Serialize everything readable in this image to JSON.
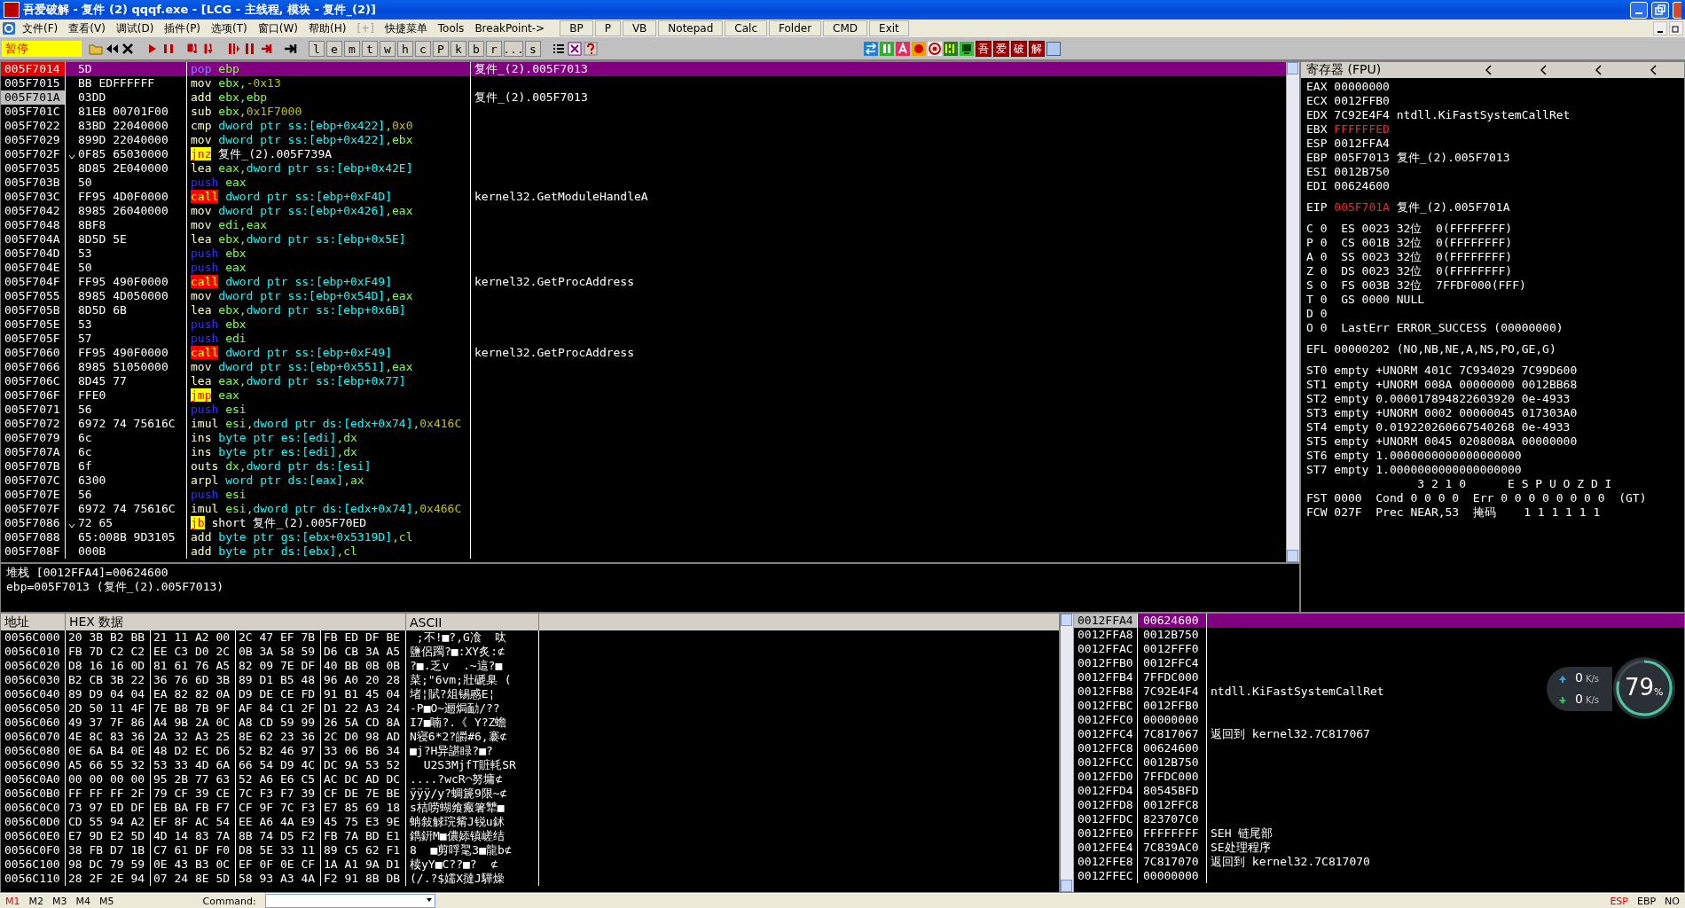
{
  "window": {
    "title": "吾爱破解 - 复件 (2) qqqf.exe - [LCG - 主线程, 模块 - 复件_(2)]"
  },
  "menu": [
    {
      "label": "文件(F)",
      "disabled": false
    },
    {
      "label": "查看(V)",
      "disabled": false
    },
    {
      "label": "调试(D)",
      "disabled": false
    },
    {
      "label": "插件(P)",
      "disabled": false
    },
    {
      "label": "选项(T)",
      "disabled": false
    },
    {
      "label": "窗口(W)",
      "disabled": false
    },
    {
      "label": "帮助(H)",
      "disabled": false
    },
    {
      "label": "[+]",
      "disabled": true
    },
    {
      "label": "快捷菜单",
      "disabled": false
    },
    {
      "label": "Tools",
      "disabled": false
    },
    {
      "label": "BreakPoint->",
      "disabled": false
    }
  ],
  "menu_buttons": [
    "BP",
    "P",
    "VB",
    "Notepad",
    "Calc",
    "Folder",
    "CMD",
    "Exit"
  ],
  "toolbar": {
    "status": "暂停",
    "letter_buttons": [
      "l",
      "e",
      "m",
      "t",
      "w",
      "h",
      "c",
      "P",
      "k",
      "b",
      "r",
      "...",
      "s"
    ],
    "brand_buttons": [
      "吾",
      "爱",
      "破",
      "解"
    ]
  },
  "disassembly": {
    "rows": [
      {
        "address": "005F7014",
        "hex": "5D",
        "mnemonic": "pop",
        "operands": "ebp",
        "kind": "stack",
        "branch": false,
        "selected": true,
        "current": false,
        "comment": "复件_(2).005F7013"
      },
      {
        "address": "005F7015",
        "hex": "BB EDFFFFFF",
        "mnemonic": "mov",
        "operands": "ebx,-0x13",
        "kind": "plain",
        "branch": false,
        "selected": false,
        "current": false
      },
      {
        "address": "005F701A",
        "hex": "03DD",
        "mnemonic": "add",
        "operands": "ebx,ebp",
        "kind": "plain",
        "branch": false,
        "selected": false,
        "current": true,
        "comment": "复件_(2).005F7013"
      },
      {
        "address": "005F701C",
        "hex": "81EB 00701F00",
        "mnemonic": "sub",
        "operands": "ebx,0x1F7000",
        "kind": "plain",
        "branch": false,
        "selected": false,
        "current": false
      },
      {
        "address": "005F7022",
        "hex": "83BD 22040000",
        "mnemonic": "cmp",
        "operands": "dword ptr ss:[ebp+0x422],0x0",
        "kind": "plain",
        "branch": false,
        "selected": false,
        "current": false
      },
      {
        "address": "005F7029",
        "hex": "899D 22040000",
        "mnemonic": "mov",
        "operands": "dword ptr ss:[ebp+0x422],ebx",
        "kind": "plain",
        "branch": false,
        "selected": false,
        "current": false
      },
      {
        "address": "005F702F",
        "hex": "0F85 65030000",
        "mnemonic": "jnz",
        "operands": "复件_(2).005F739A",
        "kind": "jump",
        "branch": true,
        "selected": false,
        "current": false
      },
      {
        "address": "005F7035",
        "hex": "8D85 2E040000",
        "mnemonic": "lea",
        "operands": "eax,dword ptr ss:[ebp+0x42E]",
        "kind": "plain",
        "branch": false,
        "selected": false,
        "current": false
      },
      {
        "address": "005F703B",
        "hex": "50",
        "mnemonic": "push",
        "operands": "eax",
        "kind": "stack",
        "branch": false,
        "selected": false,
        "current": false
      },
      {
        "address": "005F703C",
        "hex": "FF95 4D0F0000",
        "mnemonic": "call",
        "operands": "dword ptr ss:[ebp+0xF4D]",
        "kind": "call",
        "branch": false,
        "selected": false,
        "current": false,
        "comment": "kernel32.GetModuleHandleA"
      },
      {
        "address": "005F7042",
        "hex": "8985 26040000",
        "mnemonic": "mov",
        "operands": "dword ptr ss:[ebp+0x426],eax",
        "kind": "plain",
        "branch": false,
        "selected": false,
        "current": false
      },
      {
        "address": "005F7048",
        "hex": "8BF8",
        "mnemonic": "mov",
        "operands": "edi,eax",
        "kind": "plain",
        "branch": false,
        "selected": false,
        "current": false
      },
      {
        "address": "005F704A",
        "hex": "8D5D 5E",
        "mnemonic": "lea",
        "operands": "ebx,dword ptr ss:[ebp+0x5E]",
        "kind": "plain",
        "branch": false,
        "selected": false,
        "current": false
      },
      {
        "address": "005F704D",
        "hex": "53",
        "mnemonic": "push",
        "operands": "ebx",
        "kind": "stack",
        "branch": false,
        "selected": false,
        "current": false
      },
      {
        "address": "005F704E",
        "hex": "50",
        "mnemonic": "push",
        "operands": "eax",
        "kind": "stack",
        "branch": false,
        "selected": false,
        "current": false
      },
      {
        "address": "005F704F",
        "hex": "FF95 490F0000",
        "mnemonic": "call",
        "operands": "dword ptr ss:[ebp+0xF49]",
        "kind": "call",
        "branch": false,
        "selected": false,
        "current": false,
        "comment": "kernel32.GetProcAddress"
      },
      {
        "address": "005F7055",
        "hex": "8985 4D050000",
        "mnemonic": "mov",
        "operands": "dword ptr ss:[ebp+0x54D],eax",
        "kind": "plain",
        "branch": false,
        "selected": false,
        "current": false
      },
      {
        "address": "005F705B",
        "hex": "8D5D 6B",
        "mnemonic": "lea",
        "operands": "ebx,dword ptr ss:[ebp+0x6B]",
        "kind": "plain",
        "branch": false,
        "selected": false,
        "current": false
      },
      {
        "address": "005F705E",
        "hex": "53",
        "mnemonic": "push",
        "operands": "ebx",
        "kind": "stack",
        "branch": false,
        "selected": false,
        "current": false
      },
      {
        "address": "005F705F",
        "hex": "57",
        "mnemonic": "push",
        "operands": "edi",
        "kind": "stack",
        "branch": false,
        "selected": false,
        "current": false
      },
      {
        "address": "005F7060",
        "hex": "FF95 490F0000",
        "mnemonic": "call",
        "operands": "dword ptr ss:[ebp+0xF49]",
        "kind": "call",
        "branch": false,
        "selected": false,
        "current": false,
        "comment": "kernel32.GetProcAddress"
      },
      {
        "address": "005F7066",
        "hex": "8985 51050000",
        "mnemonic": "mov",
        "operands": "dword ptr ss:[ebp+0x551],eax",
        "kind": "plain",
        "branch": false,
        "selected": false,
        "current": false
      },
      {
        "address": "005F706C",
        "hex": "8D45 77",
        "mnemonic": "lea",
        "operands": "eax,dword ptr ss:[ebp+0x77]",
        "kind": "plain",
        "branch": false,
        "selected": false,
        "current": false
      },
      {
        "address": "005F706F",
        "hex": "FFE0",
        "mnemonic": "jmp",
        "operands": "eax",
        "kind": "jump",
        "branch": false,
        "selected": false,
        "current": false
      },
      {
        "address": "005F7071",
        "hex": "56",
        "mnemonic": "push",
        "operands": "esi",
        "kind": "stack",
        "branch": false,
        "selected": false,
        "current": false
      },
      {
        "address": "005F7072",
        "hex": "6972 74 75616C",
        "mnemonic": "imul",
        "operands": "esi,dword ptr ds:[edx+0x74],0x416C",
        "kind": "plain",
        "branch": false,
        "selected": false,
        "current": false
      },
      {
        "address": "005F7079",
        "hex": "6c",
        "mnemonic": "ins",
        "operands": "byte ptr es:[edi],dx",
        "kind": "plain",
        "branch": false,
        "selected": false,
        "current": false
      },
      {
        "address": "005F707A",
        "hex": "6c",
        "mnemonic": "ins",
        "operands": "byte ptr es:[edi],dx",
        "kind": "plain",
        "branch": false,
        "selected": false,
        "current": false
      },
      {
        "address": "005F707B",
        "hex": "6f",
        "mnemonic": "outs",
        "operands": "dx,dword ptr ds:[esi]",
        "kind": "plain",
        "branch": false,
        "selected": false,
        "current": false
      },
      {
        "address": "005F707C",
        "hex": "6300",
        "mnemonic": "arpl",
        "operands": "word ptr ds:[eax],ax",
        "kind": "plain",
        "branch": false,
        "selected": false,
        "current": false
      },
      {
        "address": "005F707E",
        "hex": "56",
        "mnemonic": "push",
        "operands": "esi",
        "kind": "stack",
        "branch": false,
        "selected": false,
        "current": false
      },
      {
        "address": "005F707F",
        "hex": "6972 74 75616C",
        "mnemonic": "imul",
        "operands": "esi,dword ptr ds:[edx+0x74],0x466C",
        "kind": "plain",
        "branch": false,
        "selected": false,
        "current": false
      },
      {
        "address": "005F7086",
        "hex": "72 65",
        "mnemonic": "jb",
        "operands": "short 复件_(2).005F70ED",
        "kind": "jump",
        "branch": true,
        "selected": false,
        "current": false
      },
      {
        "address": "005F7088",
        "hex": "65:008B 9D3105",
        "mnemonic": "add",
        "operands": "byte ptr gs:[ebx+0x5319D],cl",
        "kind": "plain",
        "branch": false,
        "selected": false,
        "current": false
      },
      {
        "address": "005F708F",
        "hex": "000B",
        "mnemonic": "add",
        "operands": "byte ptr ds:[ebx],cl",
        "kind": "plain",
        "branch": false,
        "selected": false,
        "current": false
      }
    ]
  },
  "info": [
    "堆栈 [0012FFA4]=00624600",
    "ebp=005F7013 (复件_(2).005F7013)"
  ],
  "registers": {
    "title": "寄存器 (FPU)",
    "sections": [
      [
        {
          "kind": "reg",
          "name": "EAX",
          "value": "00000000",
          "changed": false
        },
        {
          "kind": "reg",
          "name": "ECX",
          "value": "0012FFB0",
          "changed": false
        },
        {
          "kind": "reg",
          "name": "EDX",
          "value": "7C92E4F4",
          "changed": false,
          "comment": "ntdll.KiFastSystemCallRet"
        },
        {
          "kind": "reg",
          "name": "EBX",
          "value": "FFFFFFED",
          "changed": true
        },
        {
          "kind": "reg",
          "name": "ESP",
          "value": "0012FFA4",
          "changed": false
        },
        {
          "kind": "reg",
          "name": "EBP",
          "value": "005F7013",
          "changed": false,
          "comment": "复件_(2).005F7013"
        },
        {
          "kind": "reg",
          "name": "ESI",
          "value": "0012B750",
          "changed": false
        },
        {
          "kind": "reg",
          "name": "EDI",
          "value": "00624600",
          "changed": false
        }
      ],
      [
        {
          "kind": "reg",
          "name": "EIP",
          "value": "005F701A",
          "changed": true,
          "comment": "复件_(2).005F701A"
        }
      ],
      [
        {
          "kind": "text",
          "text": "C 0  ES 0023 32位  0(FFFFFFFF)"
        },
        {
          "kind": "text",
          "text": "P 0  CS 001B 32位  0(FFFFFFFF)"
        },
        {
          "kind": "text",
          "text": "A 0  SS 0023 32位  0(FFFFFFFF)"
        },
        {
          "kind": "text",
          "text": "Z 0  DS 0023 32位  0(FFFFFFFF)"
        },
        {
          "kind": "text",
          "text": "S 0  FS 003B 32位  7FFDF000(FFF)"
        },
        {
          "kind": "text",
          "text": "T 0  GS 0000 NULL"
        },
        {
          "kind": "text",
          "text": "D 0"
        },
        {
          "kind": "text",
          "text": "O 0  LastErr ERROR_SUCCESS (00000000)"
        }
      ],
      [
        {
          "kind": "text",
          "text": "EFL 00000202 (NO,NB,NE,A,NS,PO,GE,G)"
        }
      ],
      [
        {
          "kind": "text",
          "text": "ST0 empty +UNORM 401C 7C934029 7C99D600"
        },
        {
          "kind": "text",
          "text": "ST1 empty +UNORM 008A 00000000 0012BB68"
        },
        {
          "kind": "text",
          "text": "ST2 empty 0.000017894822603920 0e-4933"
        },
        {
          "kind": "text",
          "text": "ST3 empty +UNORM 0002 00000045 017303A0"
        },
        {
          "kind": "text",
          "text": "ST4 empty 0.019220260667540268 0e-4933"
        },
        {
          "kind": "text",
          "text": "ST5 empty +UNORM 0045 0208008A 00000000"
        },
        {
          "kind": "text",
          "text": "ST6 empty 1.0000000000000000000"
        },
        {
          "kind": "text",
          "text": "ST7 empty 1.0000000000000000000"
        },
        {
          "kind": "text",
          "text": "                3 2 1 0      E S P U O Z D I"
        },
        {
          "kind": "text",
          "text": "FST 0000  Cond 0 0 0 0  Err 0 0 0 0 0 0 0 0  (GT)"
        },
        {
          "kind": "text",
          "text": "FCW 027F  Prec NEAR,53  掩码    1 1 1 1 1 1"
        }
      ]
    ]
  },
  "dump": {
    "columns": [
      "地址",
      "HEX 数据",
      "ASCII"
    ],
    "rows": [
      {
        "address": "0056C000",
        "hex": [
          "20 3B B2 BB",
          "21 11 A2 00",
          "2C 47 EF 7B",
          "FB ED DF BE"
        ],
        "ascii": " ;不!■?,G飡  呔"
      },
      {
        "address": "0056C010",
        "hex": [
          "FB 7D C2 C2",
          "EE C3 D0 2C",
          "0B 3A 58 59",
          "D6 CB 3A A5"
        ],
        "ascii": "鹽侶躅?■:XY炙:⊄"
      },
      {
        "address": "0056C020",
        "hex": [
          "D8 16 16 0D",
          "81 61 76 A5",
          "82 09 7E DF",
          "40 BB 0B 0B"
        ],
        "ascii": "?■.乏v  .~這?■"
      },
      {
        "address": "0056C030",
        "hex": [
          "B2 CB 3B 22",
          "36 76 6D 3B",
          "89 D1 B5 48",
          "96 A0 20 28"
        ],
        "ascii": "菜;\"6vm;壯磃臬 ("
      },
      {
        "address": "0056C040",
        "hex": [
          "89 D9 04 04",
          "EA 82 82 0A",
          "D9 DE CE FD",
          "91 B1 45 04"
        ],
        "ascii": "堵¦賦?俎锡慼E¦"
      },
      {
        "address": "0056C050",
        "hex": [
          "2D 50 11 4F",
          "7E B8 7B 9F",
          "AF 84 C1 2F",
          "D1 22 A3 24"
        ],
        "ascii": "-P■O~逦焗勔/??"
      },
      {
        "address": "0056C060",
        "hex": [
          "49 37 7F 86",
          "A4 9B 2A 0C",
          "A8 CD 59 99",
          "26 5A CD 8A"
        ],
        "ascii": "I7■喃?.《 Y?Z蟾"
      },
      {
        "address": "0056C070",
        "hex": [
          "4E 8C 83 36",
          "2A 32 A3 25",
          "8E 62 23 36",
          "2C D0 98 AD"
        ],
        "ascii": "N寝6*2?皭#6,褰⊄"
      },
      {
        "address": "0056C080",
        "hex": [
          "0E 6A B4 0E",
          "48 D2 EC D6",
          "52 B2 46 97",
          "33 06 B6 34"
        ],
        "ascii": "■j?H异諶睩?■?"
      },
      {
        "address": "0056C090",
        "hex": [
          "A5 66 55 32",
          "53 33 4D 6A",
          "66 54 D9 4C",
          "DC 9A 53 52"
        ],
        "ascii": "  U2S3MjfT賍軞SR"
      },
      {
        "address": "0056C0A0",
        "hex": [
          "00 00 00 00",
          "95 2B 77 63",
          "52 A6 E6 C5",
          "AC DC AD DC"
        ],
        "ascii": "....?wcR⌒努墉⊄"
      },
      {
        "address": "0056C0B0",
        "hex": [
          "FF FF FF 2F",
          "79 CF 39 CE",
          "7C F3 F7 39",
          "CF DE 7E BE"
        ],
        "ascii": "ÿÿÿ/y?蜩篪9限~⊄"
      },
      {
        "address": "0056C0C0",
        "hex": [
          "73 97 ED DF",
          "EB BA FB F7",
          "CF 9F 7C F3",
          "E7 85 69 18"
        ],
        "ascii": "s桔唠蝴飨瘢箸犨■"
      },
      {
        "address": "0056C0D0",
        "hex": [
          "CD 55 94 A2",
          "EF 8F AC 54",
          "EE A6 4A E9",
          "45 75 E3 9E"
        ],
        "ascii": "蚺敍觩琓觜J锐u鉥"
      },
      {
        "address": "0056C0E0",
        "hex": [
          "E7 9D E2 5D",
          "4D 14 83 7A",
          "8B 74 D5 F2",
          "FB 7A BD E1"
        ],
        "ascii": "鐫銒M■儂婖镇嵯结"
      },
      {
        "address": "0056C0F0",
        "hex": [
          "38 FB D7 1B",
          "C7 61 DF F0",
          "D8 5E 33 11",
          "89 C5 62 F1"
        ],
        "ascii": "8  ■剪哹毣3■龍b⊄"
      },
      {
        "address": "0056C100",
        "hex": [
          "98 DC 79 59",
          "0E 43 B3 0C",
          "EF 0F 0E CF",
          "1A A1 9A D1"
        ],
        "ascii": "椟yY■C??■?  ⊄"
      },
      {
        "address": "0056C110",
        "hex": [
          "28 2F 2E 94",
          "07 24 8E 5D",
          "58 93 A3 4A",
          "F2 91 8B DB"
        ],
        "ascii": "(/.?$嬬X撻J驊燥"
      }
    ]
  },
  "stack": {
    "rows": [
      {
        "address": "0012FFA4",
        "value": "00624600",
        "selected": true
      },
      {
        "address": "0012FFA8",
        "value": "0012B750",
        "selected": false
      },
      {
        "address": "0012FFAC",
        "value": "0012FFF0",
        "selected": false
      },
      {
        "address": "0012FFB0",
        "value": "0012FFC4",
        "selected": false
      },
      {
        "address": "0012FFB4",
        "value": "7FFDC000",
        "selected": false
      },
      {
        "address": "0012FFB8",
        "value": "7C92E4F4",
        "selected": false,
        "comment": "ntdll.KiFastSystemCallRet"
      },
      {
        "address": "0012FFBC",
        "value": "0012FFB0",
        "selected": false
      },
      {
        "address": "0012FFC0",
        "value": "00000000",
        "selected": false
      },
      {
        "address": "0012FFC4",
        "value": "7C817067",
        "selected": false,
        "comment": "返回到 kernel32.7C817067"
      },
      {
        "address": "0012FFC8",
        "value": "00624600",
        "selected": false
      },
      {
        "address": "0012FFCC",
        "value": "0012B750",
        "selected": false
      },
      {
        "address": "0012FFD0",
        "value": "7FFDC000",
        "selected": false
      },
      {
        "address": "0012FFD4",
        "value": "80545BFD",
        "selected": false
      },
      {
        "address": "0012FFD8",
        "value": "0012FFC8",
        "selected": false
      },
      {
        "address": "0012FFDC",
        "value": "823707C0",
        "selected": false
      },
      {
        "address": "0012FFE0",
        "value": "FFFFFFFF",
        "selected": false,
        "comment": "SEH 链尾部"
      },
      {
        "address": "0012FFE4",
        "value": "7C839AC0",
        "selected": false,
        "comment": "SE处理程序"
      },
      {
        "address": "0012FFE8",
        "value": "7C817070",
        "selected": false,
        "comment": "返回到 kernel32.7C817070"
      },
      {
        "address": "0012FFEC",
        "value": "00000000",
        "selected": false
      }
    ]
  },
  "net_widget": {
    "upload": "0",
    "upload_unit": "K/s",
    "download": "0",
    "download_unit": "K/s",
    "percent": "79",
    "percent_sign": "%",
    "level": 0.79
  },
  "status_bar": {
    "memory_tabs": [
      {
        "label": "M1",
        "selected": true
      },
      {
        "label": "M2",
        "selected": false
      },
      {
        "label": "M3",
        "selected": false
      },
      {
        "label": "M4",
        "selected": false
      },
      {
        "label": "M5",
        "selected": false
      }
    ],
    "command_label": "Command:",
    "register_tabs": [
      {
        "label": "ESP",
        "selected": true
      },
      {
        "label": "EBP",
        "selected": false
      },
      {
        "label": "NO",
        "selected": false
      }
    ]
  }
}
